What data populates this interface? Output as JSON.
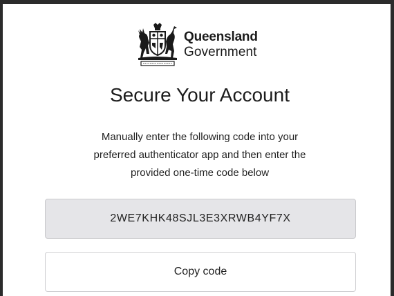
{
  "logo": {
    "line1": "Queensland",
    "line2": "Government",
    "crest_icon": "queensland-coat-of-arms-icon"
  },
  "page": {
    "title": "Secure Your Account",
    "instructions": [
      "Manually enter the following code into your",
      "preferred authenticator app and then enter the",
      "provided one-time code below"
    ]
  },
  "secret_code": "2WE7KHK48SJL3E3XRWB4YF7X",
  "copy_button": {
    "label": "Copy code"
  },
  "colors": {
    "frame": "#2b2b2b",
    "code_background": "#e5e5e8",
    "text": "#222222"
  }
}
